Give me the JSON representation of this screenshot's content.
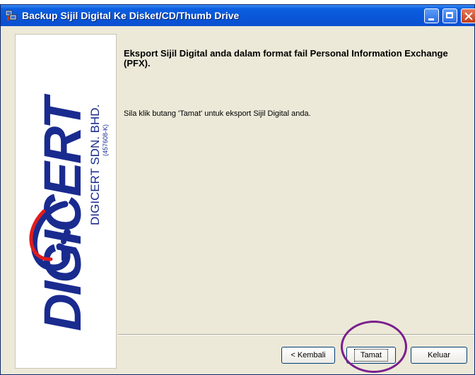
{
  "window": {
    "title": "Backup Sijil Digital Ke Disket/CD/Thumb Drive",
    "title_icon": "network-computer-icon",
    "controls": [
      "minimize-icon",
      "maximize-icon",
      "close-icon"
    ]
  },
  "logo": {
    "brand": "DIGICERT",
    "company": "DIGICERT SDN. BHD.",
    "reg_no": "(457608-K)"
  },
  "content": {
    "heading": "Eksport Sijil Digital anda dalam format fail Personal Information Exchange (PFX).",
    "instruction": "Sila klik butang 'Tamat' untuk eksport Sijil Digital anda."
  },
  "buttons": {
    "back": "< Kembali",
    "finish": "Tamat",
    "exit": "Keluar"
  },
  "colors": {
    "titlebar": "#0a56d8",
    "dialog_bg": "#ece9d8",
    "logo_blue": "#1a2b8f",
    "highlight": "#7b1f8e"
  }
}
